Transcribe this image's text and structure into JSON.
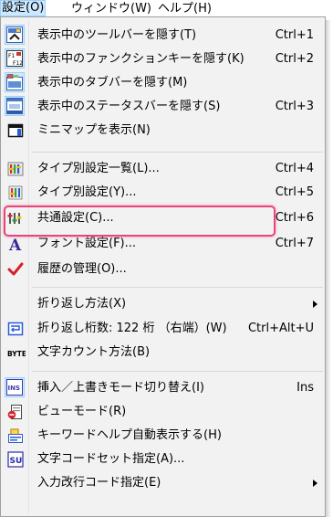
{
  "menubar": {
    "settings": "設定(O)",
    "window": "ウィンドウ(W)",
    "help": "ヘルプ(H)"
  },
  "menu": {
    "items": [
      {
        "label": "表示中のツールバーを隠す(T)",
        "shortcut": "Ctrl+1",
        "icon": "toolbar-icon"
      },
      {
        "label": "表示中のファンクションキーを隠す(K)",
        "shortcut": "Ctrl+2",
        "icon": "function-keys-icon"
      },
      {
        "label": "表示中のタブバーを隠す(M)",
        "shortcut": "",
        "icon": "tabbar-icon"
      },
      {
        "label": "表示中のステータスバーを隠す(S)",
        "shortcut": "Ctrl+3",
        "icon": "statusbar-icon"
      },
      {
        "label": "ミニマップを表示(N)",
        "shortcut": "",
        "icon": "minimap-icon"
      },
      {
        "label": "タイプ別設定一覧(L)...",
        "shortcut": "Ctrl+4",
        "icon": "type-settings-list-icon"
      },
      {
        "label": "タイプ別設定(Y)...",
        "shortcut": "Ctrl+5",
        "icon": "type-settings-icon"
      },
      {
        "label": "共通設定(C)...",
        "shortcut": "Ctrl+6",
        "icon": "common-settings-icon"
      },
      {
        "label": "フォント設定(F)...",
        "shortcut": "Ctrl+7",
        "icon": "font-icon"
      },
      {
        "label": "履歴の管理(O)...",
        "shortcut": "",
        "icon": "history-check-icon"
      },
      {
        "label": "折り返し方法(X)",
        "shortcut": "",
        "icon": ""
      },
      {
        "label": "折り返し桁数: 122 桁 （右端）(W)",
        "shortcut": "Ctrl+Alt+U",
        "icon": "wrap-column-icon"
      },
      {
        "label": "文字カウント方法(B)",
        "shortcut": "",
        "icon": "byte-count-icon"
      },
      {
        "label": "挿入／上書きモード切り替え(I)",
        "shortcut": "Ins",
        "icon": "insert-mode-icon"
      },
      {
        "label": "ビューモード(R)",
        "shortcut": "",
        "icon": "view-mode-icon"
      },
      {
        "label": "キーワードヘルプ自動表示する(H)",
        "shortcut": "",
        "icon": "keyword-help-icon"
      },
      {
        "label": "文字コードセット指定(A)...",
        "shortcut": "",
        "icon": "charset-icon"
      },
      {
        "label": "入力改行コード指定(E)",
        "shortcut": "",
        "icon": ""
      }
    ],
    "byte_icon_text": "BYTE",
    "ins_icon_text": "INS",
    "su_icon_text": "SU",
    "font_icon_text": "A"
  },
  "colors": {
    "highlight_border": "#e8457a",
    "checked_bg": "#cce8ff",
    "menu_bg": "#f2f2f2"
  }
}
